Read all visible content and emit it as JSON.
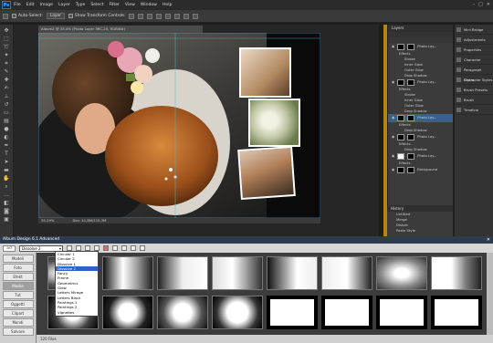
{
  "menubar": {
    "logo": "Ps",
    "items": [
      "File",
      "Edit",
      "Image",
      "Layer",
      "Type",
      "Select",
      "Filter",
      "View",
      "Window",
      "Help"
    ]
  },
  "options": {
    "auto_select": "Auto-Select:",
    "layer_select": "Layer",
    "show_transform": "Show Transform Controls"
  },
  "document": {
    "tab_title": "Album2 @ 35.4% (Photo Layer 3RC-25, RGB/8#)",
    "zoom": "35.29%",
    "doc_info": "Doc: 41,8M/115,3M"
  },
  "layers": {
    "tab": "Layers",
    "rows": [
      {
        "label": "Photo Lay...",
        "kind": "thumb",
        "thumb": "dark",
        "selected": false
      },
      {
        "label": "Effects",
        "kind": "sub",
        "selected": false
      },
      {
        "label": "Stroke",
        "kind": "sub2",
        "selected": false
      },
      {
        "label": "Inner Glow",
        "kind": "sub2",
        "selected": false
      },
      {
        "label": "Outer Glow",
        "kind": "sub2",
        "selected": false
      },
      {
        "label": "Drop Shadow",
        "kind": "sub2",
        "selected": false
      },
      {
        "label": "Photo Lay...",
        "kind": "thumb",
        "thumb": "dark",
        "selected": false
      },
      {
        "label": "Effects",
        "kind": "sub",
        "selected": false
      },
      {
        "label": "Stroke",
        "kind": "sub2",
        "selected": false
      },
      {
        "label": "Inner Glow",
        "kind": "sub2",
        "selected": false
      },
      {
        "label": "Outer Glow",
        "kind": "sub2",
        "selected": false
      },
      {
        "label": "Drop Shadow",
        "kind": "sub2",
        "selected": false
      },
      {
        "label": "Photo Lay...",
        "kind": "thumb",
        "thumb": "dark",
        "selected": true
      },
      {
        "label": "Effects",
        "kind": "sub",
        "selected": false
      },
      {
        "label": "Drop Shadow",
        "kind": "sub2",
        "selected": false
      },
      {
        "label": "Photo Lay...",
        "kind": "thumb",
        "thumb": "dark",
        "selected": false
      },
      {
        "label": "Effects",
        "kind": "sub",
        "selected": false
      },
      {
        "label": "Drop Shadow",
        "kind": "sub2",
        "selected": false
      },
      {
        "label": "Photo Lay...",
        "kind": "thumb",
        "thumb": "white",
        "selected": false
      },
      {
        "label": "Effects",
        "kind": "sub",
        "selected": false
      },
      {
        "label": "Background",
        "kind": "thumb",
        "thumb": "dark",
        "selected": false
      }
    ]
  },
  "history": {
    "tab": "History",
    "items": [
      "Untitled",
      "Merge",
      "Distort",
      "Paste Style",
      "Transform"
    ]
  },
  "side_panels": [
    "Mini Bridge",
    "Adjustments",
    "Properties",
    "Character",
    "Paragraph Styles",
    "Character Styles",
    "Brush Presets",
    "Brush",
    "Timeline"
  ],
  "album_design": {
    "title": "Album Design 6.1 Advanced",
    "logo": "ad",
    "preset": "Dissolve 2",
    "dropdown": [
      "Circular 1",
      "Circular 2",
      "Dissolve 1",
      "Dissolve 2",
      "Fancy",
      "Frame",
      "Geometrics",
      "Glow",
      "Letters Mirage",
      "Letters Black",
      "Paintings 1",
      "Paintings 2",
      "Vignettes"
    ],
    "dropdown_selected": "Dissolve 2",
    "left_buttons": [
      "Modeli",
      "Foto",
      "Efekt",
      "Maske",
      "Txt",
      "Oggetti",
      "Clipart",
      "Mondi",
      "Salvare"
    ],
    "left_active": "Maske",
    "status": "120 Files"
  },
  "colors": {
    "accent": "#3161c4",
    "ps_bg": "#2b2b2b",
    "panel": "#3b3b3b",
    "gold": "#b8860b"
  }
}
